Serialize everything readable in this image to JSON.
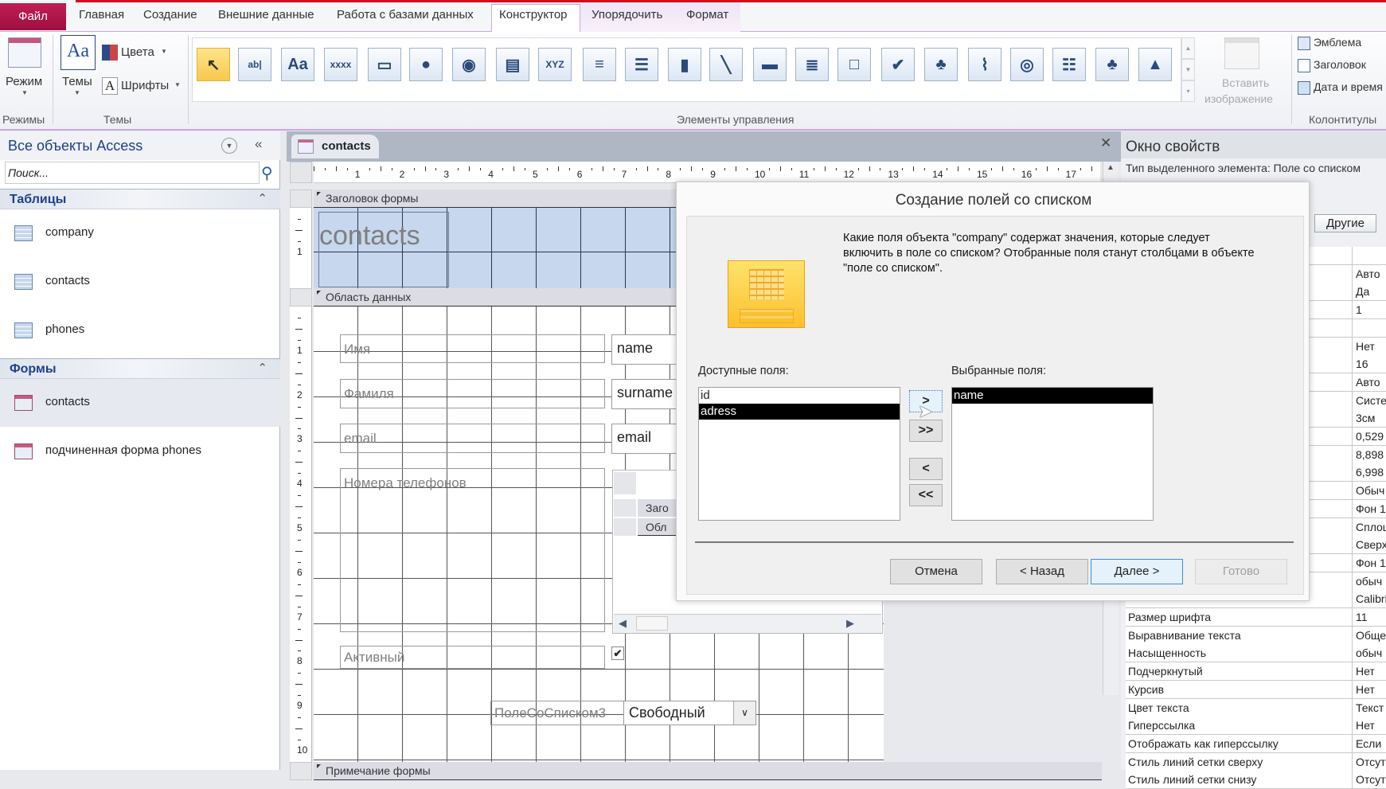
{
  "ribbon": {
    "file_tab": "Файл",
    "tabs": [
      "Главная",
      "Создание",
      "Внешние данные",
      "Работа с базами данных",
      "Конструктор",
      "Упорядочить",
      "Формат"
    ],
    "active_tab": "Конструктор",
    "mode_label": "Режим",
    "themes_label": "Темы",
    "colors_label": "Цвета",
    "fonts_label": "Шрифты",
    "groups": {
      "modes": "Режимы",
      "themes": "Темы",
      "controls": "Элементы управления",
      "headers": "Колонтитулы"
    },
    "insert_image": [
      "Вставить",
      "изображение"
    ],
    "header_items": [
      "Эмблема",
      "Заголовок",
      "Дата и время"
    ],
    "controls": [
      {
        "name": "select-pointer-icon",
        "glyph": "↖"
      },
      {
        "name": "textbox-icon",
        "glyph": "ab|"
      },
      {
        "name": "label-icon",
        "glyph": "Aa"
      },
      {
        "name": "button-icon",
        "glyph": "xxxx"
      },
      {
        "name": "tab-control-icon",
        "glyph": "▭"
      },
      {
        "name": "hyperlink-icon",
        "glyph": "●"
      },
      {
        "name": "web-browser-icon",
        "glyph": "◉"
      },
      {
        "name": "navigation-control-icon",
        "glyph": "▤"
      },
      {
        "name": "option-group-icon",
        "glyph": "XYZ"
      },
      {
        "name": "page-break-icon",
        "glyph": "≡"
      },
      {
        "name": "combo-box-icon",
        "glyph": "☰"
      },
      {
        "name": "chart-icon",
        "glyph": "▮"
      },
      {
        "name": "line-icon",
        "glyph": "╲"
      },
      {
        "name": "toggle-button-icon",
        "glyph": "▬"
      },
      {
        "name": "list-box-icon",
        "glyph": "≣"
      },
      {
        "name": "rectangle-icon",
        "glyph": "□"
      },
      {
        "name": "checkbox-icon",
        "glyph": "✔"
      },
      {
        "name": "unbound-object-frame-icon",
        "glyph": "♣"
      },
      {
        "name": "attachment-icon",
        "glyph": "⌇"
      },
      {
        "name": "option-button-icon",
        "glyph": "◎"
      },
      {
        "name": "subform-icon",
        "glyph": "☷"
      },
      {
        "name": "bound-object-frame-icon",
        "glyph": "♣"
      },
      {
        "name": "image-icon",
        "glyph": "▲"
      }
    ],
    "accent": "#b0174b"
  },
  "nav": {
    "title": "Все объекты Access",
    "search_placeholder": "Поиск...",
    "sections": [
      {
        "title": "Таблицы",
        "items": [
          "company",
          "contacts",
          "phones"
        ]
      },
      {
        "title": "Формы",
        "items": [
          "contacts",
          "подчиненная форма phones"
        ]
      }
    ],
    "selected_item": "contacts"
  },
  "document": {
    "tab_label": "contacts",
    "ruler_numbers": [
      "1",
      "2",
      "3",
      "4",
      "5",
      "6",
      "7",
      "8",
      "9",
      "10",
      "11",
      "12",
      "13",
      "14",
      "15",
      "16",
      "17"
    ],
    "sections": {
      "header": "Заголовок формы",
      "detail": "Область данных",
      "footer": "Примечание формы"
    },
    "header_title": "contacts",
    "controls": {
      "name_label": "Имя",
      "name_field": "name",
      "surname_label": "Фамиля",
      "surname_field": "surname",
      "email_label": "email",
      "email_field": "email",
      "phones_label": "Номера телефонов",
      "subform_header": "Заго",
      "subform_detail": "Обл",
      "active_label": "Активный",
      "active_checked": true,
      "combo_label": "ПолеСоСписком3",
      "combo_value": "Свободный"
    }
  },
  "properties": {
    "title": "Окно свойств",
    "selection_type": "Тип выделенного элемента:  Поле со списком",
    "tab": "Другие",
    "rows": [
      {
        "label": "",
        "value": ""
      },
      {
        "label": "",
        "value": "Авто"
      },
      {
        "label": "",
        "value": "Да"
      },
      {
        "label": "",
        "value": "1"
      },
      {
        "label": "",
        "value": ""
      },
      {
        "label": "",
        "value": "Нет"
      },
      {
        "label": "",
        "value": "16"
      },
      {
        "label": "",
        "value": "Авто"
      },
      {
        "label": "",
        "value": "Систе"
      },
      {
        "label": "",
        "value": "3см"
      },
      {
        "label": "",
        "value": "0,529"
      },
      {
        "label": "",
        "value": "8,898"
      },
      {
        "label": "",
        "value": "6,998"
      },
      {
        "label": "",
        "value": "Обыч"
      },
      {
        "label": "",
        "value": "Фон 1"
      },
      {
        "label": "",
        "value": "Сплош"
      },
      {
        "label": "",
        "value": "Сверх"
      },
      {
        "label": "",
        "value": "Фон 1"
      },
      {
        "label": "",
        "value": "обыч"
      },
      {
        "label": "",
        "value": "Calibri"
      },
      {
        "label": "Размер шрифта",
        "value": "11"
      },
      {
        "label": "Выравнивание текста",
        "value": "Обще"
      },
      {
        "label": "Насыщенность",
        "value": "обыч"
      },
      {
        "label": "Подчеркнутый",
        "value": "Нет"
      },
      {
        "label": "Курсив",
        "value": "Нет"
      },
      {
        "label": "Цвет текста",
        "value": "Текст"
      },
      {
        "label": "Гиперссылка",
        "value": "Нет"
      },
      {
        "label": "Отображать как гиперссылку",
        "value": "Если"
      },
      {
        "label": "Стиль линий сетки сверху",
        "value": "Отсут"
      },
      {
        "label": "Стиль линий сетки снизу",
        "value": "Отсут"
      }
    ]
  },
  "dialog": {
    "title": "Создание полей со списком",
    "question": "Какие поля объекта \"company\" содержат значения, которые следует включить в поле со списком? Отобранные поля станут столбцами в объекте \"поле со списком\".",
    "available_label": "Доступные поля:",
    "selected_label": "Выбранные поля:",
    "available_fields": [
      "id",
      "adress"
    ],
    "available_selected": "adress",
    "selected_fields": [
      "name"
    ],
    "move_buttons": [
      ">",
      ">>",
      "<",
      "<<"
    ],
    "buttons": {
      "cancel": "Отмена",
      "back": "< Назад",
      "next": "Далее >",
      "finish": "Готово"
    }
  }
}
